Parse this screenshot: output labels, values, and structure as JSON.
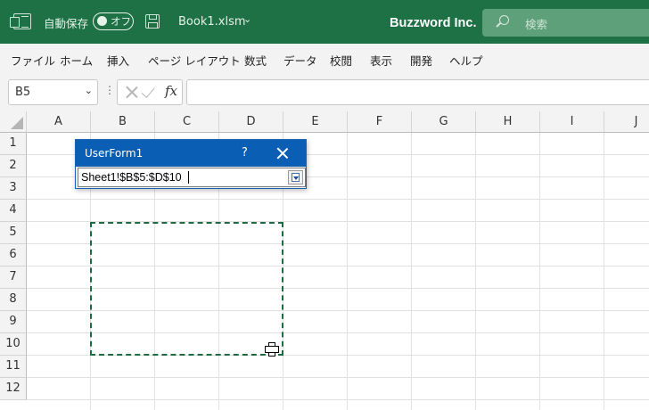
{
  "titlebar": {
    "autosave_label": "自動保存",
    "autosave_toggle": "オフ",
    "filename": "Book1.xlsm",
    "filename_chevron": "⌄",
    "company": "Buzzword Inc.",
    "search_placeholder": "検索",
    "background_color": "#1e7145"
  },
  "menu": [
    "ファイル",
    "ホーム",
    "挿入",
    "ページ レイアウト",
    "数式",
    "データ",
    "校閲",
    "表示",
    "開発",
    "ヘルプ"
  ],
  "formula_bar": {
    "name_box": "B5",
    "name_box_chevron": "⌄",
    "fx": "fx",
    "formula": ""
  },
  "sheet": {
    "columns": [
      "A",
      "B",
      "C",
      "D",
      "E",
      "F",
      "G",
      "H",
      "I",
      "J"
    ],
    "rows": [
      "1",
      "2",
      "3",
      "4",
      "5",
      "6",
      "7",
      "8",
      "9",
      "10",
      "11",
      "12"
    ],
    "selection_color": "#1e6b3f"
  },
  "userform": {
    "title": "UserForm1",
    "help": "?",
    "refedit_value": "Sheet1!$B$5:$D$10",
    "title_color": "#0a5fb4"
  }
}
